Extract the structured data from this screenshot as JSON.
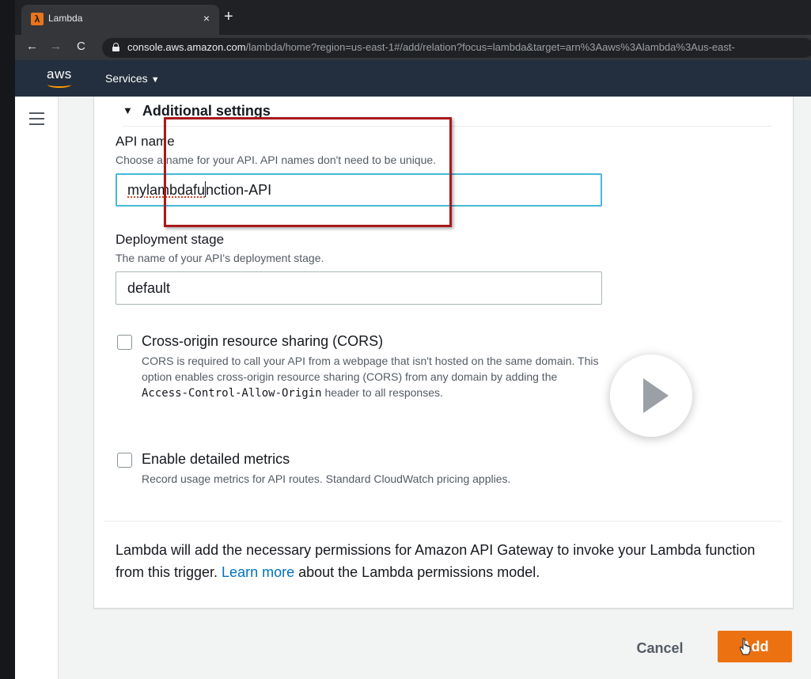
{
  "browser": {
    "tab_title": "Lambda",
    "tab_close": "×",
    "new_tab": "+",
    "url_domain": "console.aws.amazon.com",
    "url_path": "/lambda/home?region=us-east-1#/add/relation?focus=lambda&target=arn%3Aaws%3Alambda%3Aus-east-",
    "back": "←",
    "forward": "→",
    "reload": "C"
  },
  "aws_nav": {
    "logo": "aws",
    "services_label": "Services",
    "services_caret": "▼"
  },
  "form": {
    "section_toggle": "▼",
    "section_title": "Additional settings",
    "api_name": {
      "label": "API name",
      "description": "Choose a name for your API. API names don't need to be unique.",
      "value_part1": "mylambdafu",
      "value_part2": "nction-API"
    },
    "deployment_stage": {
      "label": "Deployment stage",
      "description": "The name of your API's deployment stage.",
      "value": "default"
    },
    "cors": {
      "title": "Cross-origin resource sharing (CORS)",
      "desc_before": "CORS is required to call your API from a webpage that isn't hosted on the same domain. This option enables cross-origin resource sharing (CORS) from any domain by adding the ",
      "desc_code": "Access-Control-Allow-Origin",
      "desc_after": " header to all responses.",
      "checked": false
    },
    "metrics": {
      "title": "Enable detailed metrics",
      "description": "Record usage metrics for API routes. Standard CloudWatch pricing applies.",
      "checked": false
    },
    "permissions": {
      "text_before": "Lambda will add the necessary permissions for Amazon API Gateway to invoke your Lambda function from this trigger. ",
      "link": "Learn more",
      "text_after": " about the Lambda permissions model."
    }
  },
  "actions": {
    "cancel_label": "Cancel",
    "add_label": "Add"
  },
  "colors": {
    "accent_orange": "#ec7211",
    "focus_blue": "#44b9d6",
    "highlight_red": "#a8191c",
    "link_blue": "#0073bb"
  }
}
